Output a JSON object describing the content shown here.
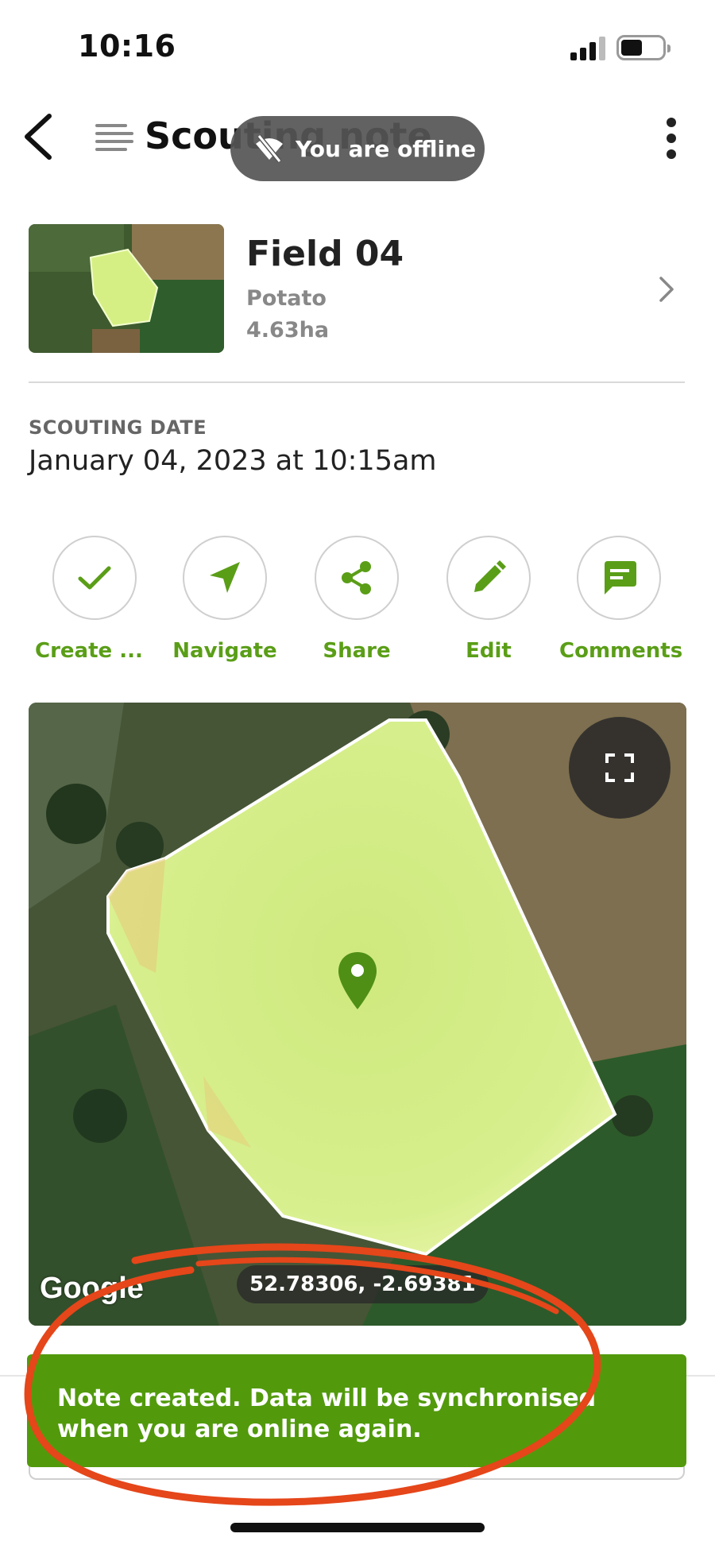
{
  "status_bar": {
    "time": "10:16"
  },
  "header": {
    "title": "Scouting note",
    "back_icon": "chevron-left-icon",
    "note_icon": "lines-icon",
    "menu_icon": "kebab-menu-icon"
  },
  "offline_banner": {
    "text": "You are offline",
    "icon": "wifi-off-icon"
  },
  "field": {
    "name": "Field 04",
    "crop": "Potato",
    "area": "4.63ha"
  },
  "scouting_date": {
    "label": "SCOUTING DATE",
    "value": "January 04, 2023 at 10:15am"
  },
  "actions": [
    {
      "label": "Create ...",
      "icon": "check-icon"
    },
    {
      "label": "Navigate",
      "icon": "navigation-arrow-icon"
    },
    {
      "label": "Share",
      "icon": "share-icon"
    },
    {
      "label": "Edit",
      "icon": "pencil-icon"
    },
    {
      "label": "Comments",
      "icon": "chat-bubble-icon"
    }
  ],
  "map": {
    "logo": "Google",
    "coordinates": "52.78306, -2.69381",
    "fullscreen_icon": "fullscreen-icon"
  },
  "toast": {
    "text": "Note created. Data will be synchronised when you are online again."
  },
  "colors": {
    "accent": "#5a9e17",
    "toast_bg": "#529a0c",
    "annotation": "#e5461a"
  }
}
